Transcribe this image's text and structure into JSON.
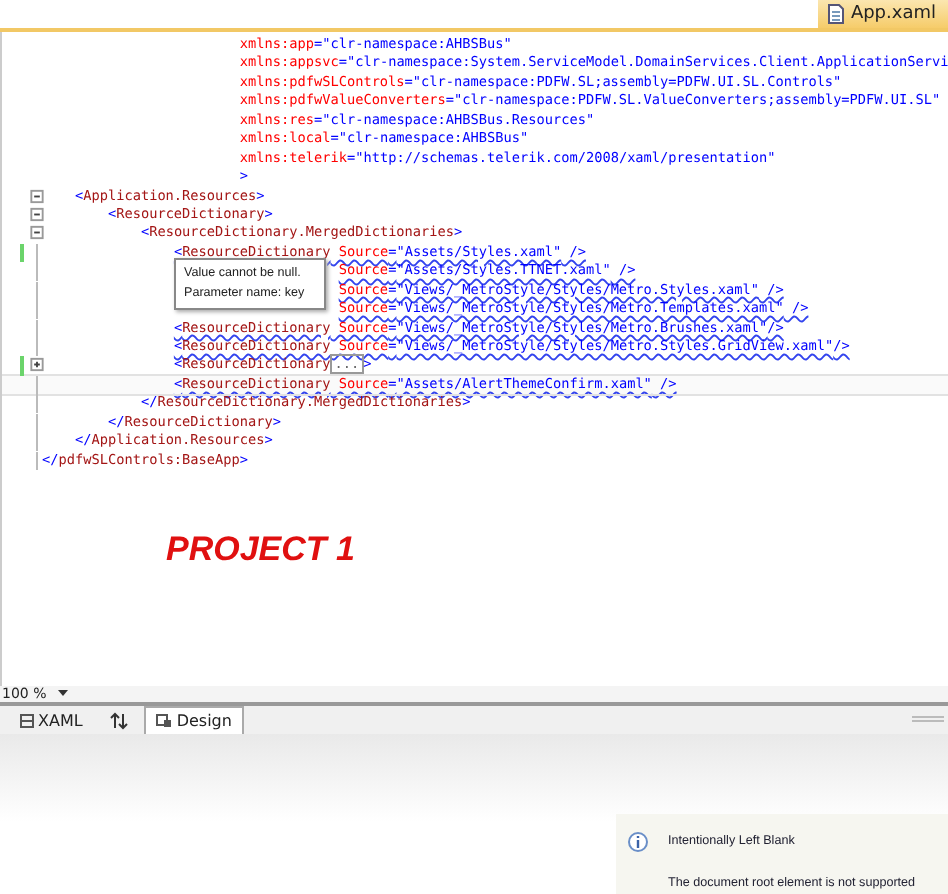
{
  "document_tab": {
    "title": "App.xaml",
    "selected": true
  },
  "code_lines": [
    {
      "changed": false,
      "squiggle": false,
      "current": false,
      "obscured": false,
      "segments": [
        {
          "kind": "attr",
          "text": "                        xmlns:app"
        },
        {
          "kind": "punct",
          "text": "="
        },
        {
          "kind": "value",
          "text": "\"clr-namespace:AHBSBus\""
        }
      ]
    },
    {
      "changed": false,
      "squiggle": false,
      "current": false,
      "obscured": false,
      "segments": [
        {
          "kind": "attr",
          "text": "                        xmlns:appsvc"
        },
        {
          "kind": "punct",
          "text": "="
        },
        {
          "kind": "value",
          "text": "\"clr-namespace:System.ServiceModel.DomainServices.Client.ApplicationServi"
        }
      ]
    },
    {
      "changed": false,
      "squiggle": false,
      "current": false,
      "obscured": false,
      "segments": [
        {
          "kind": "attr",
          "text": "                        xmlns:pdfwSLControls"
        },
        {
          "kind": "punct",
          "text": "="
        },
        {
          "kind": "value",
          "text": "\"clr-namespace:PDFW.SL;assembly=PDFW.UI.SL.Controls\""
        }
      ]
    },
    {
      "changed": false,
      "squiggle": false,
      "current": false,
      "obscured": false,
      "segments": [
        {
          "kind": "attr",
          "text": "                        xmlns:pdfwValueConverters"
        },
        {
          "kind": "punct",
          "text": "="
        },
        {
          "kind": "value",
          "text": "\"clr-namespace:PDFW.SL.ValueConverters;assembly=PDFW.UI.SL\""
        }
      ]
    },
    {
      "changed": false,
      "squiggle": false,
      "current": false,
      "obscured": false,
      "segments": [
        {
          "kind": "attr",
          "text": "                        xmlns:res"
        },
        {
          "kind": "punct",
          "text": "="
        },
        {
          "kind": "value",
          "text": "\"clr-namespace:AHBSBus.Resources\""
        }
      ]
    },
    {
      "changed": false,
      "squiggle": false,
      "current": false,
      "obscured": false,
      "segments": [
        {
          "kind": "attr",
          "text": "                        xmlns:local"
        },
        {
          "kind": "punct",
          "text": "="
        },
        {
          "kind": "value",
          "text": "\"clr-namespace:AHBSBus\""
        }
      ]
    },
    {
      "changed": false,
      "squiggle": false,
      "current": false,
      "obscured": false,
      "segments": [
        {
          "kind": "attr",
          "text": "                        xmlns:telerik"
        },
        {
          "kind": "punct",
          "text": "="
        },
        {
          "kind": "value",
          "text": "\"http://schemas.telerik.com/2008/xaml/presentation\""
        }
      ]
    },
    {
      "changed": false,
      "squiggle": false,
      "current": false,
      "obscured": false,
      "segments": [
        {
          "kind": "punct",
          "text": "                        >"
        }
      ]
    },
    {
      "expanded": true,
      "changed": false,
      "squiggle": false,
      "current": false,
      "obscured": false,
      "segments": [
        {
          "kind": "punct",
          "text": "    <"
        },
        {
          "kind": "tag",
          "text": "Application.Resources"
        },
        {
          "kind": "punct",
          "text": ">"
        }
      ]
    },
    {
      "expanded": true,
      "changed": false,
      "squiggle": false,
      "current": false,
      "obscured": false,
      "segments": [
        {
          "kind": "punct",
          "text": "        <"
        },
        {
          "kind": "tag",
          "text": "ResourceDictionary"
        },
        {
          "kind": "punct",
          "text": ">"
        }
      ]
    },
    {
      "expanded": true,
      "changed": false,
      "squiggle": false,
      "current": false,
      "obscured": false,
      "segments": [
        {
          "kind": "punct",
          "text": "            <"
        },
        {
          "kind": "tag",
          "text": "ResourceDictionary.MergedDictionaries"
        },
        {
          "kind": "punct",
          "text": ">"
        }
      ]
    },
    {
      "changed": true,
      "squiggle": true,
      "current": false,
      "obscured": false,
      "segments": [
        {
          "kind": "punct",
          "text": "                <"
        },
        {
          "kind": "tag",
          "text": "ResourceDictionary"
        },
        {
          "kind": "attr",
          "text": " Source"
        },
        {
          "kind": "punct",
          "text": "="
        },
        {
          "kind": "value",
          "text": "\"Assets/Styles.xaml\""
        },
        {
          "kind": "punct",
          "text": " />"
        }
      ]
    },
    {
      "changed": false,
      "squiggle": true,
      "current": false,
      "obscured": true,
      "segments": [
        {
          "kind": "attr",
          "text": " Source"
        },
        {
          "kind": "punct",
          "text": "="
        },
        {
          "kind": "value",
          "text": "\"Assets/Styles.TTNET.xaml\""
        },
        {
          "kind": "punct",
          "text": " />"
        }
      ]
    },
    {
      "changed": false,
      "squiggle": true,
      "current": false,
      "obscured": true,
      "segments": [
        {
          "kind": "attr",
          "text": " Source"
        },
        {
          "kind": "punct",
          "text": "="
        },
        {
          "kind": "value",
          "text": "\"Views/_MetroStyle/Styles/Metro.Styles.xaml\""
        },
        {
          "kind": "punct",
          "text": " />"
        }
      ]
    },
    {
      "changed": false,
      "squiggle": true,
      "current": false,
      "obscured": true,
      "segments": [
        {
          "kind": "attr",
          "text": " Source"
        },
        {
          "kind": "punct",
          "text": "="
        },
        {
          "kind": "value",
          "text": "\"Views/_MetroStyle/Styles/Metro.Templates.xaml\""
        },
        {
          "kind": "punct",
          "text": " />"
        }
      ]
    },
    {
      "changed": false,
      "squiggle": true,
      "current": false,
      "obscured": false,
      "segments": [
        {
          "kind": "punct",
          "text": "                <"
        },
        {
          "kind": "tag",
          "text": "ResourceDictionary"
        },
        {
          "kind": "attr",
          "text": " Source"
        },
        {
          "kind": "punct",
          "text": "="
        },
        {
          "kind": "value",
          "text": "\"Views/_MetroStyle/Styles/Metro.Brushes.xaml\""
        },
        {
          "kind": "punct",
          "text": "/>"
        }
      ]
    },
    {
      "changed": false,
      "squiggle": true,
      "current": false,
      "obscured": false,
      "segments": [
        {
          "kind": "punct",
          "text": "                <"
        },
        {
          "kind": "tag",
          "text": "ResourceDictionary"
        },
        {
          "kind": "attr",
          "text": " Source"
        },
        {
          "kind": "punct",
          "text": "="
        },
        {
          "kind": "value",
          "text": "\"Views/_MetroStyle/Styles/Metro.Styles.GridView.xaml\""
        },
        {
          "kind": "punct",
          "text": "/>"
        }
      ]
    },
    {
      "expanded": false,
      "changed": true,
      "squiggle": false,
      "current": false,
      "obscured": false,
      "segments": [
        {
          "kind": "punct",
          "text": "                <"
        },
        {
          "kind": "tag",
          "text": "ResourceDictionary"
        },
        {
          "kind": "collapsed",
          "text": "..."
        },
        {
          "kind": "punct",
          "text": ">"
        }
      ]
    },
    {
      "changed": false,
      "squiggle": true,
      "current": true,
      "obscured": false,
      "segments": [
        {
          "kind": "punct",
          "text": "                <"
        },
        {
          "kind": "tag",
          "text": "ResourceDictionary"
        },
        {
          "kind": "attr",
          "text": " Source"
        },
        {
          "kind": "punct",
          "text": "="
        },
        {
          "kind": "value",
          "text": "\"Assets/AlertThemeConfirm.xaml\""
        },
        {
          "kind": "punct",
          "text": " />"
        }
      ]
    },
    {
      "changed": false,
      "squiggle": false,
      "current": false,
      "obscured": false,
      "segments": [
        {
          "kind": "punct",
          "text": "            </"
        },
        {
          "kind": "tag",
          "text": "ResourceDictionary.MergedDictionaries"
        },
        {
          "kind": "punct",
          "text": ">"
        }
      ]
    },
    {
      "changed": false,
      "squiggle": false,
      "current": false,
      "obscured": false,
      "segments": [
        {
          "kind": "punct",
          "text": "        </"
        },
        {
          "kind": "tag",
          "text": "ResourceDictionary"
        },
        {
          "kind": "punct",
          "text": ">"
        }
      ]
    },
    {
      "changed": false,
      "squiggle": false,
      "current": false,
      "obscured": false,
      "segments": [
        {
          "kind": "punct",
          "text": "    </"
        },
        {
          "kind": "tag",
          "text": "Application.Resources"
        },
        {
          "kind": "punct",
          "text": ">"
        }
      ]
    },
    {
      "changed": false,
      "squiggle": false,
      "current": false,
      "obscured": false,
      "segments": [
        {
          "kind": "punct",
          "text": "</"
        },
        {
          "kind": "tag",
          "text": "pdfwSLControls:BaseApp"
        },
        {
          "kind": "punct",
          "text": ">"
        }
      ]
    }
  ],
  "tooltip": {
    "lines": [
      "Value cannot be null.",
      "Parameter name: key"
    ]
  },
  "annotation": "PROJECT 1",
  "zoom": {
    "value": "100 %"
  },
  "view_tabs": [
    {
      "kind": "tab",
      "label": "XAML",
      "selected": false
    },
    {
      "kind": "swap"
    },
    {
      "kind": "tab",
      "label": "Design",
      "selected": true
    }
  ],
  "info_panel": {
    "title": "Intentionally Left Blank",
    "message": "The document root element is not supported"
  }
}
